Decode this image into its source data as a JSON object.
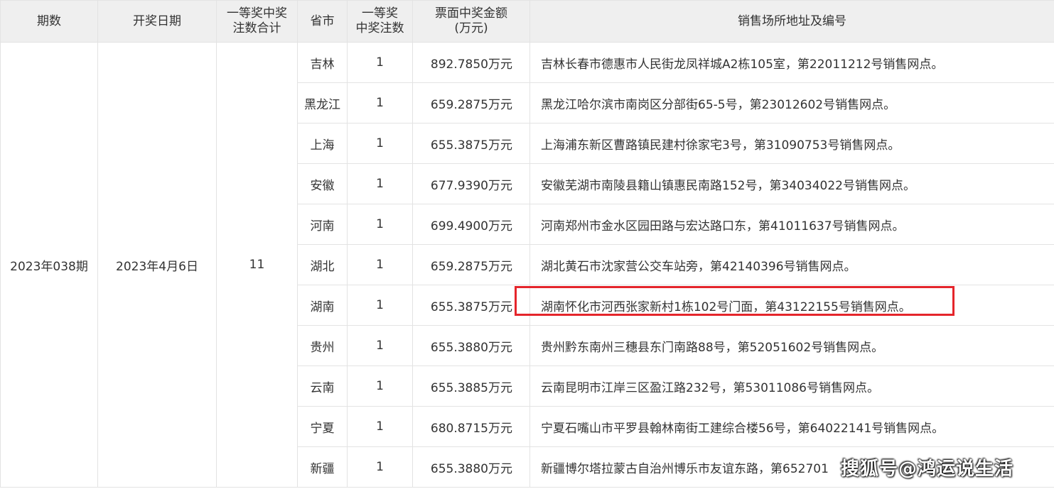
{
  "headers": {
    "period": "期数",
    "draw_date": "开奖日期",
    "total_line1": "一等奖中奖",
    "total_line2": "注数合计",
    "province": "省市",
    "count_line1": "一等奖",
    "count_line2": "中奖注数",
    "amount_line1": "票面中奖金额",
    "amount_line2": "(万元)",
    "address": "销售场所地址及编号"
  },
  "summary": {
    "period": "2023年038期",
    "draw_date": "2023年4月6日",
    "total": "11"
  },
  "rows": [
    {
      "province": "吉林",
      "count": "1",
      "amount": "892.7850万元",
      "address": "吉林长春市德惠市人民街龙凤祥城A2栋105室，第22011212号销售网点。"
    },
    {
      "province": "黑龙江",
      "count": "1",
      "amount": "659.2875万元",
      "address": "黑龙江哈尔滨市南岗区分部街65-5号，第23012602号销售网点。"
    },
    {
      "province": "上海",
      "count": "1",
      "amount": "655.3875万元",
      "address": "上海浦东新区曹路镇民建村徐家宅3号，第31090753号销售网点。"
    },
    {
      "province": "安徽",
      "count": "1",
      "amount": "677.9390万元",
      "address": "安徽芜湖市南陵县籍山镇惠民南路152号，第34034022号销售网点。"
    },
    {
      "province": "河南",
      "count": "1",
      "amount": "699.4900万元",
      "address": "河南郑州市金水区园田路与宏达路口东，第41011637号销售网点。"
    },
    {
      "province": "湖北",
      "count": "1",
      "amount": "659.2875万元",
      "address": "湖北黄石市沈家营公交车站旁，第42140396号销售网点。"
    },
    {
      "province": "湖南",
      "count": "1",
      "amount": "655.3875万元",
      "address": "湖南怀化市河西张家新村1栋102号门面，第43122155号销售网点。"
    },
    {
      "province": "贵州",
      "count": "1",
      "amount": "655.3880万元",
      "address": "贵州黔东南州三穗县东门南路88号，第52051602号销售网点。"
    },
    {
      "province": "云南",
      "count": "1",
      "amount": "655.3885万元",
      "address": "云南昆明市江岸三区盈江路232号，第53011086号销售网点。"
    },
    {
      "province": "宁夏",
      "count": "1",
      "amount": "680.8715万元",
      "address": "宁夏石嘴山市平罗县翰林南街工建综合楼56号，第64022141号销售网点。"
    },
    {
      "province": "新疆",
      "count": "1",
      "amount": "655.3880万元",
      "address": "新疆博尔塔拉蒙古自治州博乐市友谊东路，第652701"
    }
  ],
  "watermark": "搜狐号@鸿运说生活",
  "colors": {
    "header_bg": "#efefef",
    "border": "#e3e3e3",
    "highlight": "#e5252b",
    "text": "#333333"
  }
}
